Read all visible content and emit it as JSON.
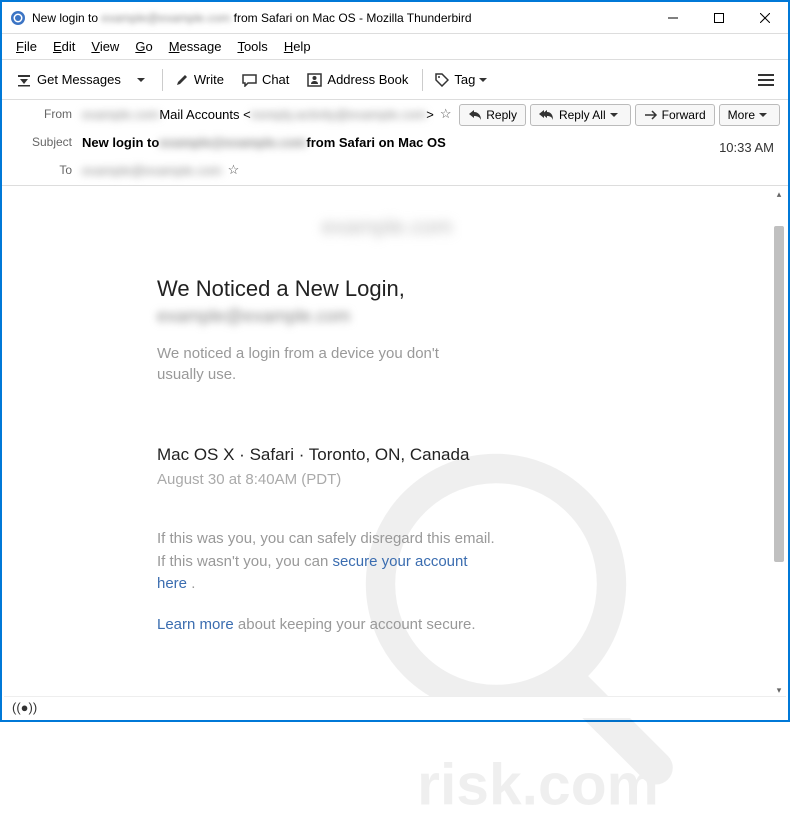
{
  "window": {
    "title_prefix": "New login to",
    "title_redacted": "example@example.com",
    "title_suffix": "from Safari on Mac OS - Mozilla Thunderbird"
  },
  "menubar": {
    "file": "File",
    "edit": "Edit",
    "view": "View",
    "go": "Go",
    "message": "Message",
    "tools": "Tools",
    "help": "Help"
  },
  "toolbar": {
    "get_messages": "Get Messages",
    "write": "Write",
    "chat": "Chat",
    "address_book": "Address Book",
    "tag": "Tag"
  },
  "actions": {
    "reply": "Reply",
    "reply_all": "Reply All",
    "forward": "Forward",
    "more": "More"
  },
  "headers": {
    "from_label": "From",
    "from_redacted_name": "example.com",
    "from_account": " Mail Accounts <",
    "from_redacted_email": "noreply.activity@example.com",
    "from_close": ">",
    "subject_label": "Subject",
    "subject_prefix": "New login to ",
    "subject_redacted": "example@example.com",
    "subject_suffix": " from Safari on Mac OS",
    "to_label": "To",
    "to_redacted": "example@example.com",
    "time": "10:33 AM"
  },
  "email_body": {
    "domain_blur": "example.com",
    "heading": "We Noticed a New Login,",
    "heading_email": "example@example.com",
    "intro": "We noticed a login from a device you don't usually use.",
    "device": "Mac OS X · Safari · Toronto, ON, Canada",
    "date": "August 30  at 8:40AM (PDT)",
    "p2a": "If this was you, you can safely disregard this email. If this wasn't you, you can ",
    "p2link": "secure your account here",
    "p2dot": " .",
    "p3link": "Learn more",
    "p3rest": " about keeping your account secure."
  }
}
